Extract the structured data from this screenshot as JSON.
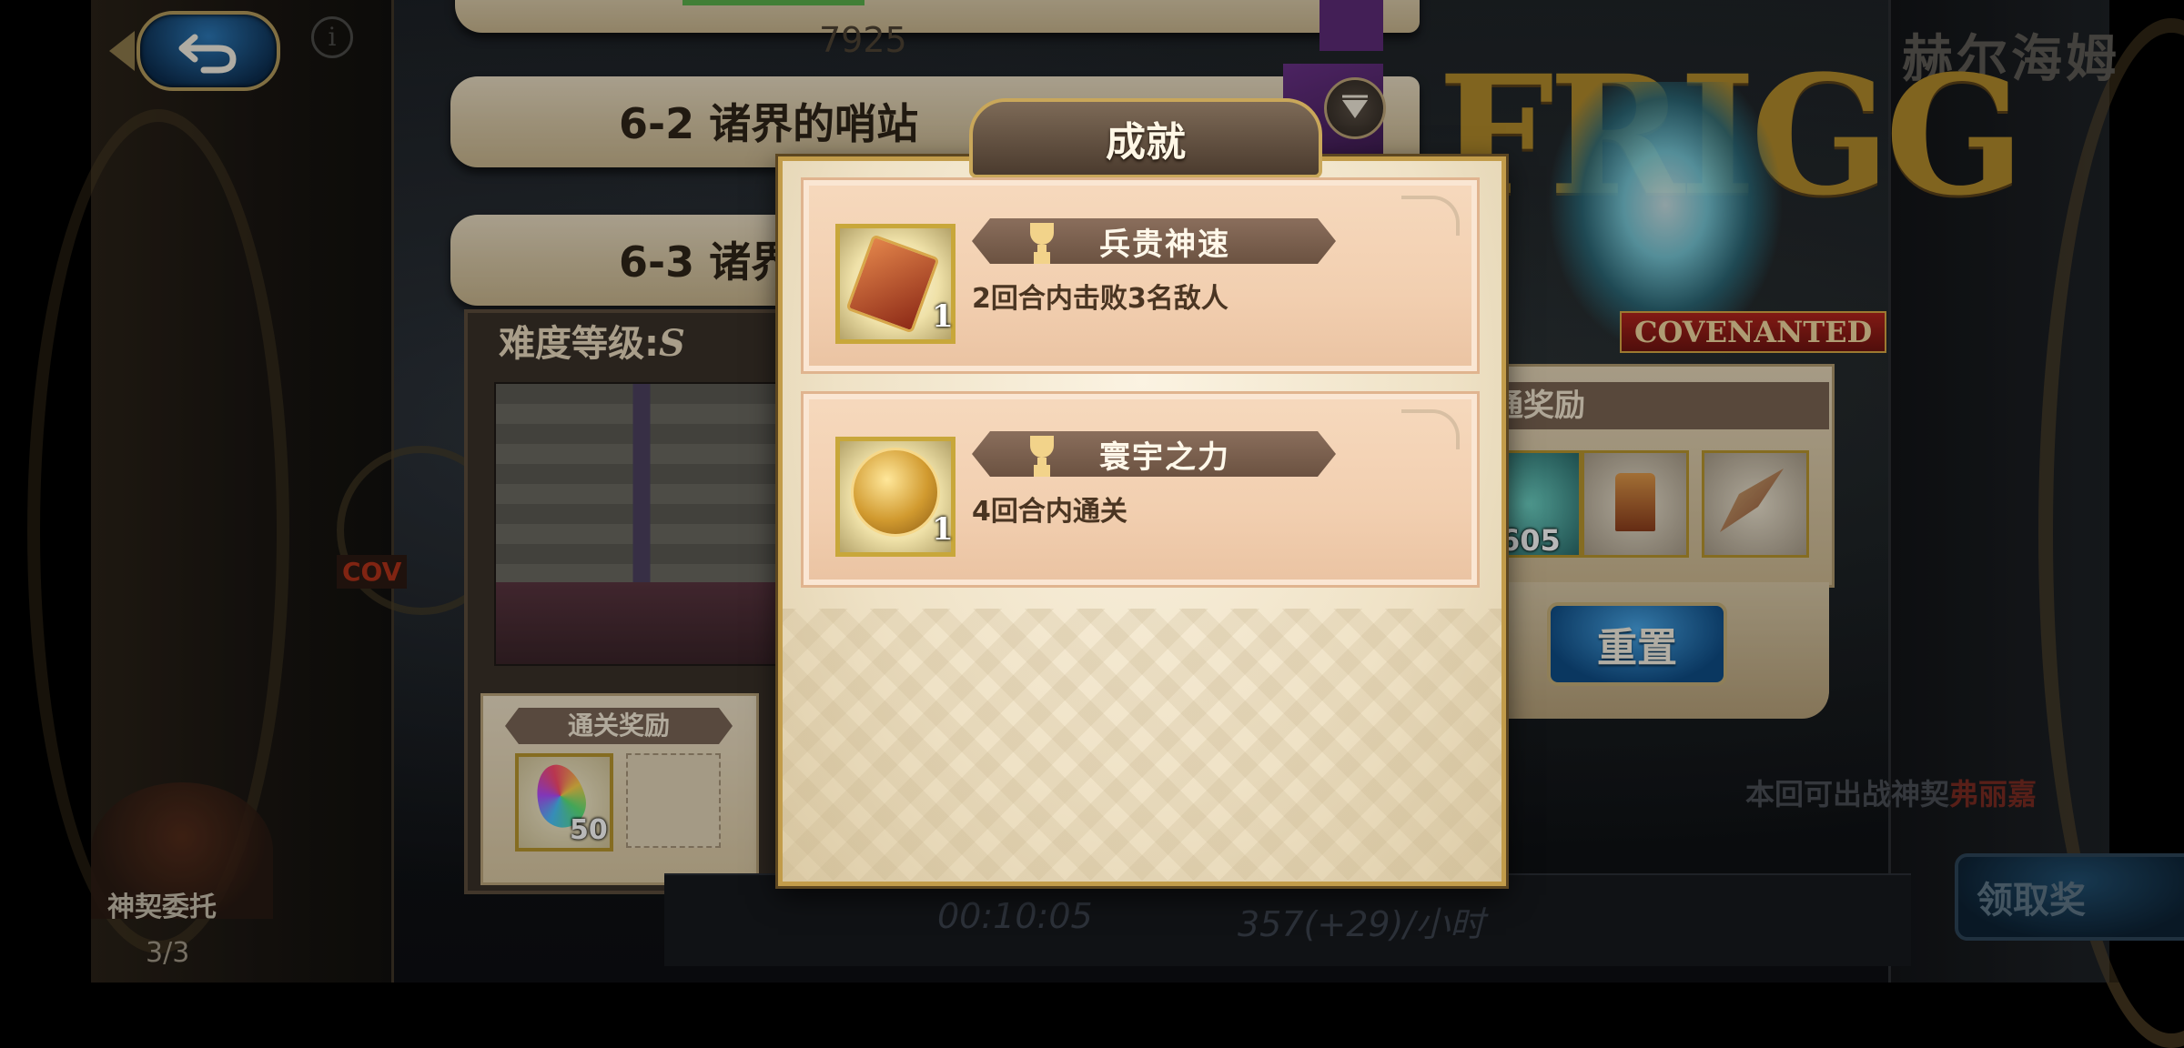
{
  "header": {
    "character_name": "赫尔海姆"
  },
  "left_panel": {
    "commission_label": "神契委托",
    "commission_count": "3/3",
    "covenant_tag": "COV"
  },
  "stages": {
    "top_number": "7925",
    "stage_2": "6-2 诸界的哨站",
    "stage_3": "6-3 诸界"
  },
  "stage_detail": {
    "difficulty_label": "难度等级:",
    "difficulty_value": "S",
    "clear_reward_header": "通关奖励",
    "clear_reward_count": "50"
  },
  "stats": {
    "time": "00:10:05",
    "rate": "357(+29)/小时"
  },
  "right_panel": {
    "logo": "FRIGG",
    "covenanted_badge": "COVENANTED",
    "normal_reward_header": "通奖励",
    "normal_reward_count": "605",
    "reset_label": "重置",
    "notice_prefix": "本回",
    "notice_obscured": "可出战神契",
    "notice_highlight": "弗丽嘉",
    "claim_label": "领取奖"
  },
  "modal": {
    "title": "成就",
    "achievements": [
      {
        "name": "兵贵神速",
        "description": "2回合内击败3名敌人",
        "quantity": "1",
        "icon": "ticket-icon"
      },
      {
        "name": "寰宇之力",
        "description": "4回合内通关",
        "quantity": "1",
        "icon": "coin-icon"
      }
    ]
  },
  "colors": {
    "modal_gold_border": "#c29c4a",
    "card_peach": "#f2cfb0",
    "banner_brown": "#7a6050",
    "button_blue": "#2c79b8"
  }
}
